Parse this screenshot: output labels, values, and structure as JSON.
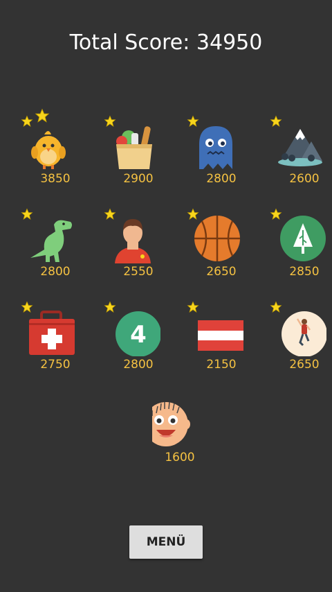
{
  "header": {
    "total_score_text": "Total Score: 34950"
  },
  "colors": {
    "background": "#333333",
    "score_text": "#f5c242",
    "star": "#f7d51d"
  },
  "levels": [
    {
      "name": "chick",
      "score": "3850",
      "stars": 2
    },
    {
      "name": "groceries",
      "score": "2900",
      "stars": 1
    },
    {
      "name": "ghost",
      "score": "2800",
      "stars": 1
    },
    {
      "name": "mountains",
      "score": "2600",
      "stars": 1
    },
    {
      "name": "dinosaur",
      "score": "2800",
      "stars": 1
    },
    {
      "name": "football-player",
      "score": "2550",
      "stars": 1
    },
    {
      "name": "basketball",
      "score": "2650",
      "stars": 1
    },
    {
      "name": "forest",
      "score": "2850",
      "stars": 1
    },
    {
      "name": "first-aid-kit",
      "score": "2750",
      "stars": 1
    },
    {
      "name": "number-four",
      "score": "2800",
      "stars": 1,
      "icon_text": "4"
    },
    {
      "name": "austria-flag",
      "score": "2150",
      "stars": 1
    },
    {
      "name": "climber",
      "score": "2650",
      "stars": 1
    },
    {
      "name": "smiley-face",
      "score": "1600",
      "stars": 0
    }
  ],
  "menu": {
    "button_label": "MENÜ"
  }
}
